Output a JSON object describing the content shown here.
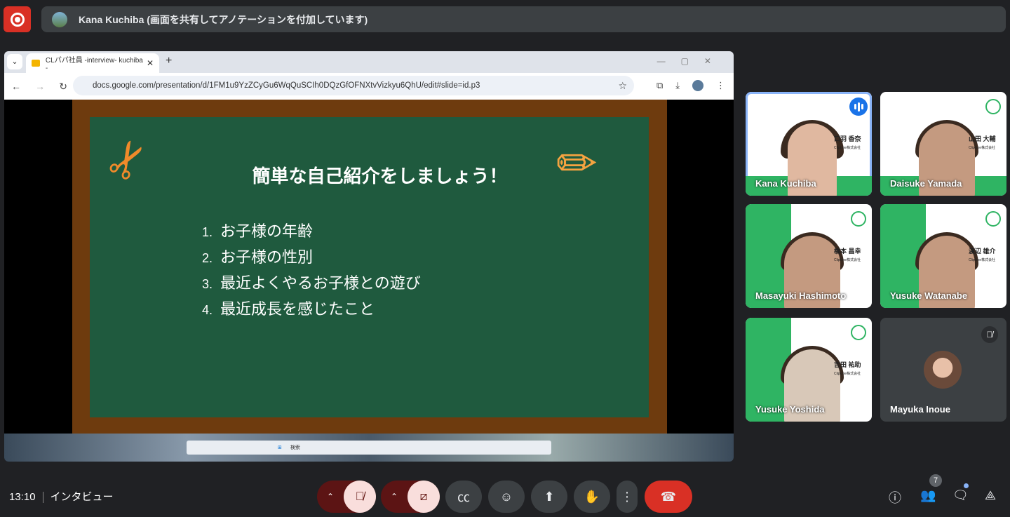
{
  "banner": {
    "text": "Kana Kuchiba (画面を共有してアノテーションを付加しています)"
  },
  "browser": {
    "tab_title": "CLパパ社員 -interview- kuchiba -",
    "url": "docs.google.com/presentation/d/1FM1u9YzZCyGu6WqQuSCIh0DQzGfOFNXtvVizkyu6QhU/edit#slide=id.p3"
  },
  "slide": {
    "title": "簡単な自己紹介をしましょう！",
    "items": [
      {
        "num": "1.",
        "text": "お子様の年齢"
      },
      {
        "num": "2.",
        "text": "お子様の性別"
      },
      {
        "num": "3.",
        "text": "最近よくやるお子様との遊び"
      },
      {
        "num": "4.",
        "text": "最近成長を感じたこと"
      }
    ]
  },
  "taskbar": {
    "search": "検索"
  },
  "participants": [
    {
      "name": "Kana Kuchiba",
      "card": "口羽 香奈",
      "company": "ClipLine株式会社"
    },
    {
      "name": "Daisuke Yamada",
      "card": "山田 大輔",
      "company": "ClipLine株式会社"
    },
    {
      "name": "Masayuki Hashimoto",
      "card": "橋本 昌幸",
      "company": "ClipLine株式会社"
    },
    {
      "name": "Yusuke Watanabe",
      "card": "渡辺 雄介",
      "company": "ClipLine株式会社"
    },
    {
      "name": "Yusuke Yoshida",
      "card": "吉田 祐助",
      "company": "ClipLine株式会社"
    },
    {
      "name": "Mayuka Inoue"
    }
  ],
  "footer": {
    "time": "13:10",
    "meeting": "インタビュー",
    "people_count": "7"
  },
  "colors": {
    "end_call": "#d93025",
    "accent": "#8ab4f8",
    "green": "#2fb463"
  }
}
